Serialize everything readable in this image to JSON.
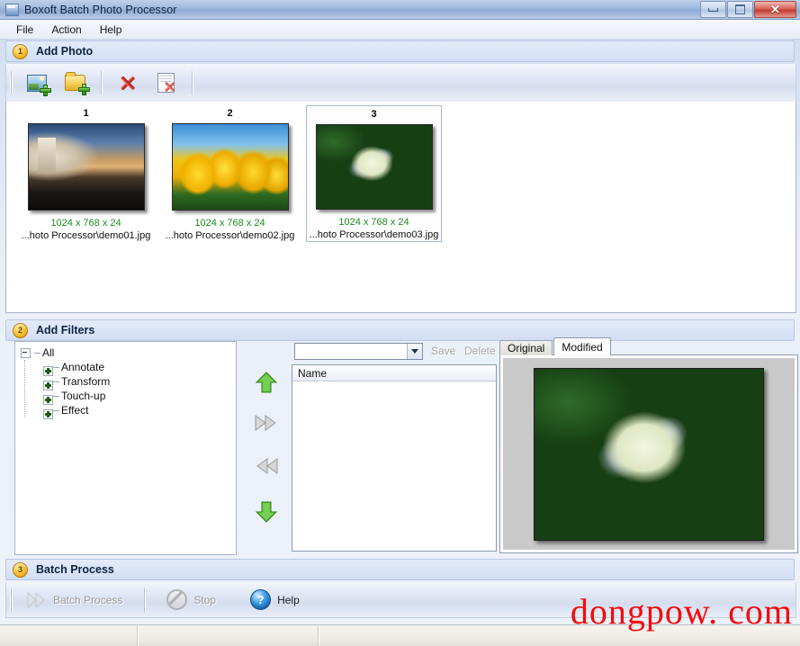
{
  "window": {
    "title": "Boxoft Batch Photo Processor",
    "icon": "app-icon",
    "buttons": {
      "minimize": "",
      "maximize": "",
      "close": "✕"
    }
  },
  "menubar": {
    "items": [
      {
        "label": "File"
      },
      {
        "label": "Action"
      },
      {
        "label": "Help"
      }
    ]
  },
  "sections": {
    "add_photo": {
      "number": "1",
      "title": "Add Photo"
    },
    "add_filters": {
      "number": "2",
      "title": "Add Filters"
    },
    "batch_process": {
      "number": "3",
      "title": "Batch Process"
    }
  },
  "toolbar": {
    "buttons": [
      {
        "name": "add-photo-button",
        "icon": "image-plus-icon"
      },
      {
        "name": "add-folder-button",
        "icon": "folder-plus-icon"
      },
      {
        "name": "delete-photo-button",
        "icon": "red-x-icon"
      },
      {
        "name": "delete-all-button",
        "icon": "document-x-icon"
      }
    ]
  },
  "photos": [
    {
      "index": "1",
      "dimensions": "1024 x 768 x 24",
      "path": "...hoto Processor\\demo01.jpg",
      "selected": false
    },
    {
      "index": "2",
      "dimensions": "1024 x 768 x 24",
      "path": "...hoto Processor\\demo02.jpg",
      "selected": false
    },
    {
      "index": "3",
      "dimensions": "1024 x 768 x 24",
      "path": "...hoto Processor\\demo03.jpg",
      "selected": true
    }
  ],
  "filter_tree": {
    "root": {
      "label": "All",
      "expanded": true
    },
    "children": [
      {
        "label": "Annotate",
        "expanded": false
      },
      {
        "label": "Transform",
        "expanded": false
      },
      {
        "label": "Touch-up",
        "expanded": false
      },
      {
        "label": "Effect",
        "expanded": false
      }
    ]
  },
  "move_buttons": [
    {
      "name": "move-up-button",
      "icon": "arrow-up-icon",
      "enabled": true
    },
    {
      "name": "add-filter-button",
      "icon": "double-arrow-right-icon",
      "enabled": false
    },
    {
      "name": "remove-filter-button",
      "icon": "double-arrow-left-icon",
      "enabled": false
    },
    {
      "name": "move-down-button",
      "icon": "arrow-down-icon",
      "enabled": true
    }
  ],
  "preset": {
    "combo_value": "",
    "combo_placeholder": "",
    "save_label": "Save",
    "delete_label": "Delete"
  },
  "filter_list": {
    "column_name": "Name",
    "rows": []
  },
  "preview": {
    "tabs": [
      {
        "label": "Original",
        "active": false
      },
      {
        "label": "Modified",
        "active": true
      }
    ]
  },
  "bottom_toolbar": {
    "batch_process": {
      "label": "Batch Process",
      "icon": "process-icon",
      "enabled": false
    },
    "stop": {
      "label": "Stop",
      "icon": "stop-icon",
      "enabled": false
    },
    "help": {
      "label": "Help",
      "icon": "help-icon",
      "enabled": true
    }
  },
  "statusbar": {
    "panes": [
      "",
      "",
      ""
    ]
  },
  "watermark": {
    "text": "dongpow. com",
    "color": "#f40b0b"
  },
  "colors": {
    "accent": "#f7c53c",
    "header_bar": "#dce4f5",
    "dimension_text": "#1f8c1f",
    "watermark": "#f40b0b"
  }
}
